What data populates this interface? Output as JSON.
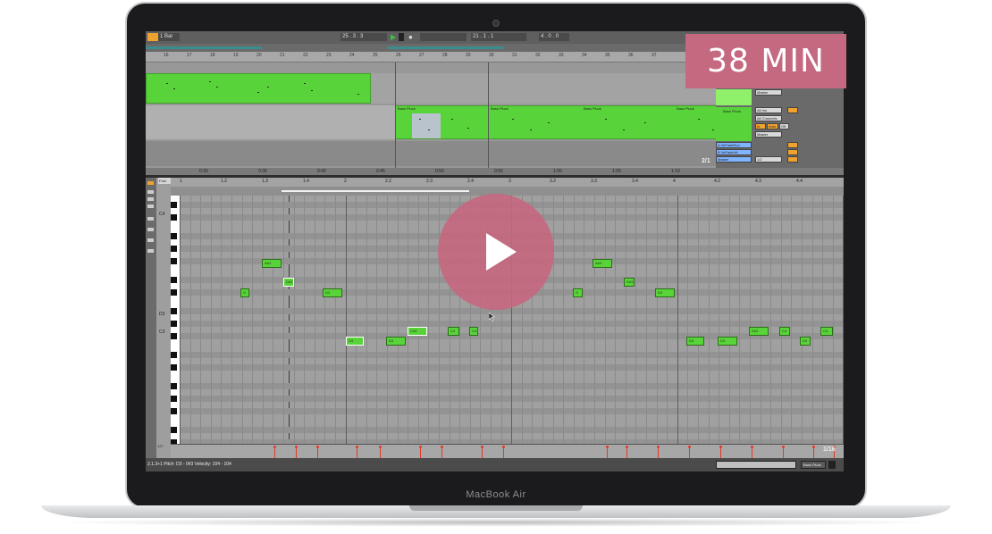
{
  "overlay": {
    "duration_badge": "38 MIN",
    "play_button": "play-icon"
  },
  "device": {
    "brand_label": "MacBook Air"
  },
  "toolbar": {
    "quantize": "1 Bar",
    "position": "25 . 3 . 3",
    "loop_start": "21 . 1 . 1",
    "loop_length": "4 . 0 . 0"
  },
  "arrangement": {
    "bar_numbers": [
      "16",
      "17",
      "18",
      "19",
      "20",
      "21",
      "22",
      "23",
      "24",
      "25",
      "26",
      "27",
      "28",
      "29",
      "30",
      "31",
      "32",
      "33",
      "34",
      "35",
      "36",
      "37"
    ],
    "clip_names": [
      "Bass Pluck",
      "Bass Pluck",
      "Bass Pluck",
      "Bass Pluck"
    ],
    "time_labels": [
      "0:30",
      "0:35",
      "0:40",
      "0:45",
      "0:50",
      "0:55",
      "1:00",
      "1:05",
      "1:10"
    ],
    "zoom_fraction": "2/1"
  },
  "mixer": {
    "track_name": "Bass Pluck",
    "output_master_1": "Master",
    "input_all_ins": "All Ins",
    "input_all_channels": "All Channels",
    "output_master_2": "Master",
    "return_a": "A VeFadeRon",
    "return_b": "B VeFadeVrt",
    "master": "Master",
    "half": "1/2",
    "auto_label": "Auto",
    "off_label": "Off",
    "in_label": "In"
  },
  "clip_view": {
    "fold_label": "Fold",
    "ruler_labels": [
      "1",
      "1.2",
      "1.3",
      "1.4",
      "2",
      "2.2",
      "2.3",
      "2.4",
      "3",
      "3.2",
      "3.3",
      "3.4",
      "4",
      "4.2",
      "4.3",
      "4.4"
    ],
    "key_labels": [
      "C4",
      "D3",
      "C3"
    ],
    "notes": [
      {
        "label": "A#3"
      },
      {
        "label": "G"
      },
      {
        "label": "D#3"
      },
      {
        "label": "D3"
      },
      {
        "label": "D3"
      },
      {
        "label": "D3"
      },
      {
        "label": "C#3"
      },
      {
        "label": "C4"
      },
      {
        "label": "C4"
      },
      {
        "label": "A#3"
      },
      {
        "label": "G"
      },
      {
        "label": "D#3"
      },
      {
        "label": "D3"
      },
      {
        "label": "D3"
      },
      {
        "label": "D3"
      },
      {
        "label": "D#3"
      },
      {
        "label": "C4"
      },
      {
        "label": "D3"
      },
      {
        "label": "C4"
      }
    ],
    "velocity_max": "127",
    "velocity_min": "0",
    "grid_fraction": "1/16"
  },
  "status": {
    "info": "2.1.3+1 Pitch: D3 - 0#3 Velocity: 104 - 104",
    "device_label": "Bass Pluck"
  }
}
